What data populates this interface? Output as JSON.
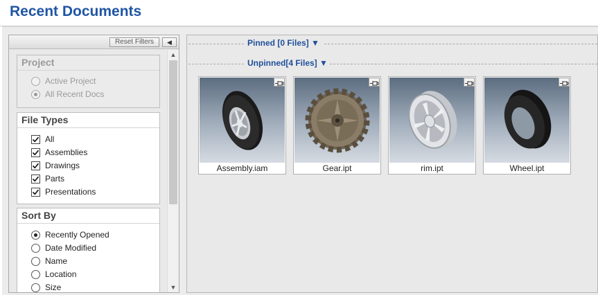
{
  "header": {
    "title": "Recent Documents"
  },
  "filters": {
    "reset_label": "Reset Filters",
    "collapse_icon": "left-triangle-icon",
    "project": {
      "title": "Project",
      "options": [
        {
          "label": "Active Project",
          "checked": false
        },
        {
          "label": "All Recent Docs",
          "checked": true
        }
      ]
    },
    "file_types": {
      "title": "File Types",
      "options": [
        {
          "label": "All",
          "checked": true
        },
        {
          "label": "Assemblies",
          "checked": true
        },
        {
          "label": "Drawings",
          "checked": true
        },
        {
          "label": "Parts",
          "checked": true
        },
        {
          "label": "Presentations",
          "checked": true
        }
      ]
    },
    "sort_by": {
      "title": "Sort By",
      "options": [
        {
          "label": "Recently Opened",
          "checked": true
        },
        {
          "label": "Date Modified",
          "checked": false
        },
        {
          "label": "Name",
          "checked": false
        },
        {
          "label": "Location",
          "checked": false
        },
        {
          "label": "Size",
          "checked": false
        }
      ]
    }
  },
  "documents": {
    "pinned_label": "Pinned [0 Files] ▼",
    "unpinned_label": "Unpinned[4 Files] ▼",
    "files": [
      {
        "name": "Assembly.iam",
        "thumb": "wheel-assembly"
      },
      {
        "name": "Gear.ipt",
        "thumb": "gear"
      },
      {
        "name": "rim.ipt",
        "thumb": "rim"
      },
      {
        "name": "Wheel.ipt",
        "thumb": "tire"
      }
    ]
  },
  "colors": {
    "title": "#1f55a5",
    "group_label": "#1f4f9a"
  }
}
